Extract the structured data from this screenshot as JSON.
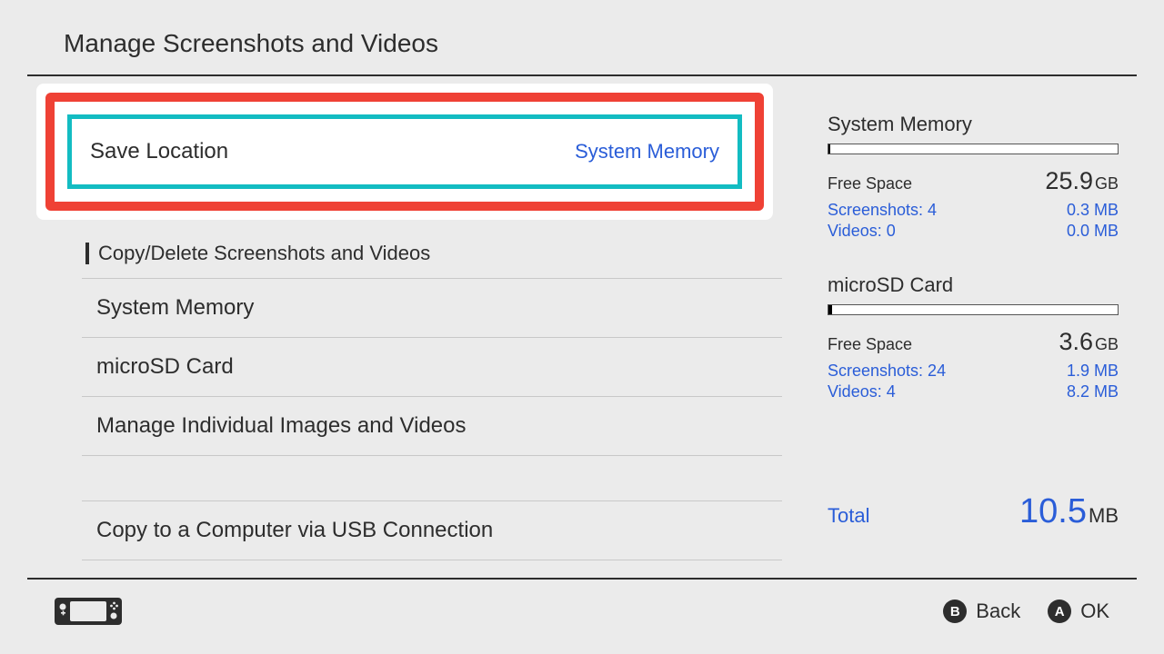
{
  "header": {
    "title": "Manage Screenshots and Videos"
  },
  "saveLocation": {
    "label": "Save Location",
    "value": "System Memory"
  },
  "list": {
    "section": "Copy/Delete Screenshots and Videos",
    "item1": "System Memory",
    "item2": "microSD Card",
    "item3": "Manage Individual Images and Videos",
    "item4": "Copy to a Computer via USB Connection"
  },
  "storage": {
    "sys": {
      "title": "System Memory",
      "freeLabel": "Free Space",
      "freeVal": "25.9",
      "freeUnit": "GB",
      "shotsLabel": "Screenshots: 4",
      "shotsVal": "0.3 MB",
      "vidsLabel": "Videos: 0",
      "vidsVal": "0.0 MB"
    },
    "sd": {
      "title": "microSD Card",
      "freeLabel": "Free Space",
      "freeVal": "3.6",
      "freeUnit": "GB",
      "shotsLabel": "Screenshots: 24",
      "shotsVal": "1.9 MB",
      "vidsLabel": "Videos: 4",
      "vidsVal": "8.2 MB"
    },
    "total": {
      "label": "Total",
      "val": "10.5",
      "unit": "MB"
    }
  },
  "footer": {
    "back": {
      "glyph": "B",
      "label": "Back"
    },
    "ok": {
      "glyph": "A",
      "label": "OK"
    }
  }
}
